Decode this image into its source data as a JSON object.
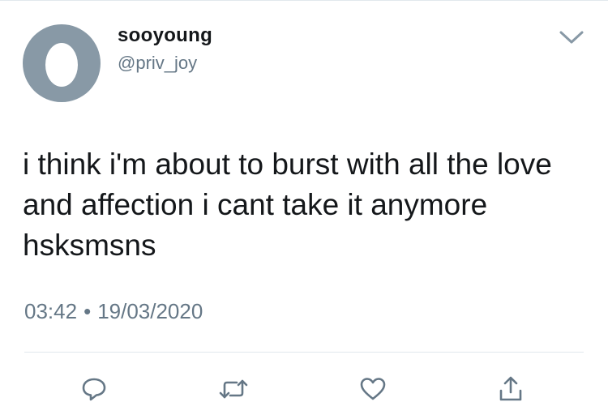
{
  "tweet": {
    "display_name": "sooyoung",
    "handle": "@priv_joy",
    "text": "i think i'm about to burst with all the love and affection i cant take it anymore hsksmsns",
    "time": "03:42",
    "separator": "•",
    "date": "19/03/2020"
  },
  "icons": {
    "avatar": "default-egg-avatar",
    "menu": "chevron-down-icon",
    "reply": "reply-icon",
    "retweet": "retweet-icon",
    "like": "heart-icon",
    "share": "share-icon"
  },
  "colors": {
    "text": "#14171a",
    "secondary": "#657786",
    "icon": "#657786",
    "avatar_bg": "#8899a6",
    "divider": "#e1e8ed"
  }
}
